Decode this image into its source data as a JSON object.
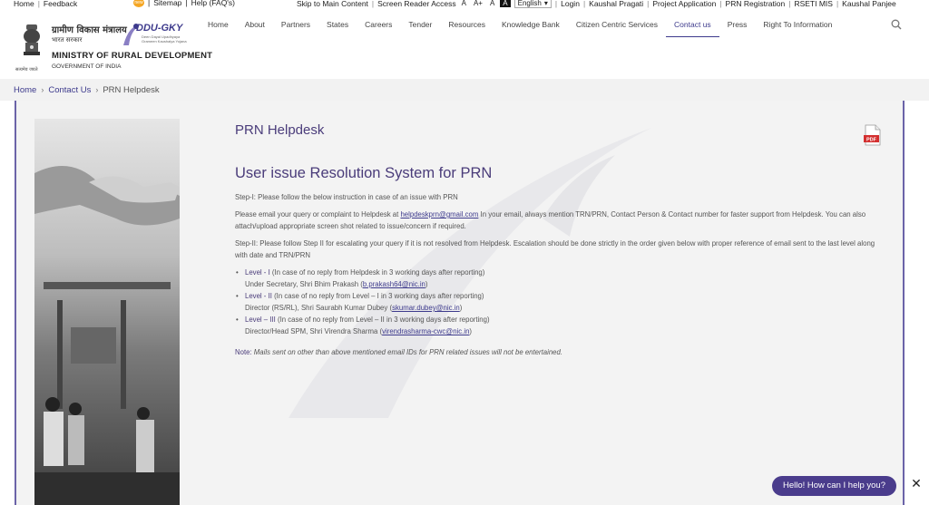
{
  "topbar": {
    "left": [
      "Home",
      "Feedback"
    ],
    "mid": [
      "Sitemap",
      "Help (FAQ's)"
    ],
    "badge": "new",
    "skip": "Skip to Main Content",
    "screen_reader": "Screen Reader Access",
    "font_sizes": [
      "A",
      "A+",
      "A",
      "A"
    ],
    "language": "English",
    "links": [
      "Login",
      "Kaushal Pragati",
      "Project Application",
      "PRN Registration",
      "RSETI MIS",
      "Kaushal Panjee"
    ]
  },
  "header": {
    "emblem_caption": "सत्यमेव जयते",
    "hindi_title": "ग्रामीण विकास मंत्रालय",
    "hindi_sub": "भारत सरकार",
    "ministry": "MINISTRY OF RURAL DEVELOPMENT",
    "government": "GOVERNMENT OF INDIA",
    "ddu_logo": "DDU-GKY",
    "ddu_sub": "Deen Dayal Upadhyaya Grameen Kaushalya Yojana"
  },
  "nav": [
    "Home",
    "About",
    "Partners",
    "States",
    "Careers",
    "Tender",
    "Resources",
    "Knowledge Bank",
    "Citizen Centric Services",
    "Contact us",
    "Press",
    "Right To Information"
  ],
  "nav_active": "Contact us",
  "breadcrumb": {
    "home": "Home",
    "contact": "Contact Us",
    "current": "PRN Helpdesk"
  },
  "page": {
    "title": "PRN Helpdesk",
    "section_title": "User issue Resolution System for PRN",
    "step1": "Step-I: Please follow the below instruction in case of an issue with PRN",
    "email_pre": "Please email your query or complaint to Helpdesk at ",
    "email": "helpdeskprn@gmail.com",
    "email_post": " In your email, always mention TRN/PRN, Contact Person & Contact number for faster support from Helpdesk. You can also attach/upload appropriate screen shot related to issue/concern if required.",
    "step2": "Step-II: Please follow Step II for escalating your query if it is not resolved from Helpdesk. Escalation should be done strictly in the order given below with proper reference of email sent to the last level along with date and TRN/PRN",
    "levels": [
      {
        "level": "Level - I",
        "cond": " (In case of no reply from Helpdesk in 3 working days after reporting)",
        "person": "Under Secretary, Shri Bhim Prakash (",
        "email": "b.prakash64@nic.in",
        "close": ")"
      },
      {
        "level": "Level - II",
        "cond": " (In case of no reply from Level – I in 3 working days after reporting)",
        "person": "Director (RS/RL), Shri Saurabh Kumar Dubey (",
        "email": "skumar.dubey@nic.in",
        "close": ")"
      },
      {
        "level": "Level – III",
        "cond": " (In case of no reply from Level – II in 3 working days after reporting)",
        "person": "Director/Head SPM, Shri Virendra Sharma (",
        "email": "virendrasharma-cwc@nic.in",
        "close": ")"
      }
    ],
    "note_label": "Note:",
    "note": " Mails sent on other than above mentioned email IDs for PRN related issues will not be entertained.",
    "pdf_label": "PDF"
  },
  "chat": {
    "label": "Hello! How can I help you?",
    "close": "✕"
  },
  "colors": {
    "accent": "#3d3a8c",
    "heading": "#4a3c7a",
    "frame": "#6b63a8",
    "chat_bg": "#4a3c8c",
    "pdf_red": "#d32f2f"
  }
}
